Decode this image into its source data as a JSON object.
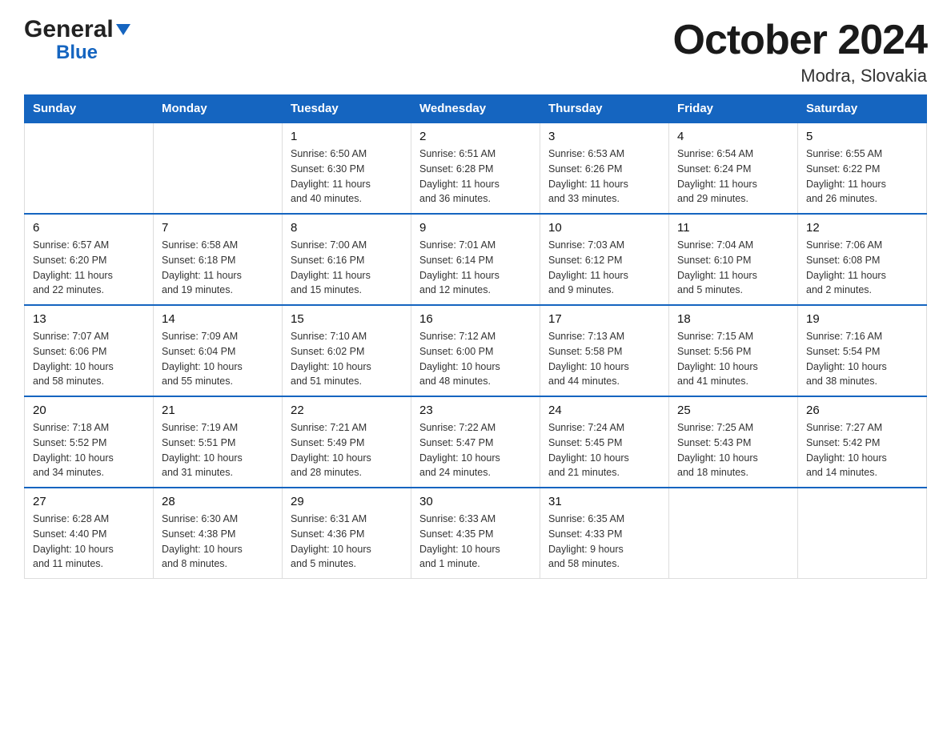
{
  "logo": {
    "general": "General",
    "blue": "Blue"
  },
  "title": "October 2024",
  "location": "Modra, Slovakia",
  "days_of_week": [
    "Sunday",
    "Monday",
    "Tuesday",
    "Wednesday",
    "Thursday",
    "Friday",
    "Saturday"
  ],
  "weeks": [
    [
      {
        "day": "",
        "info": ""
      },
      {
        "day": "",
        "info": ""
      },
      {
        "day": "1",
        "info": "Sunrise: 6:50 AM\nSunset: 6:30 PM\nDaylight: 11 hours\nand 40 minutes."
      },
      {
        "day": "2",
        "info": "Sunrise: 6:51 AM\nSunset: 6:28 PM\nDaylight: 11 hours\nand 36 minutes."
      },
      {
        "day": "3",
        "info": "Sunrise: 6:53 AM\nSunset: 6:26 PM\nDaylight: 11 hours\nand 33 minutes."
      },
      {
        "day": "4",
        "info": "Sunrise: 6:54 AM\nSunset: 6:24 PM\nDaylight: 11 hours\nand 29 minutes."
      },
      {
        "day": "5",
        "info": "Sunrise: 6:55 AM\nSunset: 6:22 PM\nDaylight: 11 hours\nand 26 minutes."
      }
    ],
    [
      {
        "day": "6",
        "info": "Sunrise: 6:57 AM\nSunset: 6:20 PM\nDaylight: 11 hours\nand 22 minutes."
      },
      {
        "day": "7",
        "info": "Sunrise: 6:58 AM\nSunset: 6:18 PM\nDaylight: 11 hours\nand 19 minutes."
      },
      {
        "day": "8",
        "info": "Sunrise: 7:00 AM\nSunset: 6:16 PM\nDaylight: 11 hours\nand 15 minutes."
      },
      {
        "day": "9",
        "info": "Sunrise: 7:01 AM\nSunset: 6:14 PM\nDaylight: 11 hours\nand 12 minutes."
      },
      {
        "day": "10",
        "info": "Sunrise: 7:03 AM\nSunset: 6:12 PM\nDaylight: 11 hours\nand 9 minutes."
      },
      {
        "day": "11",
        "info": "Sunrise: 7:04 AM\nSunset: 6:10 PM\nDaylight: 11 hours\nand 5 minutes."
      },
      {
        "day": "12",
        "info": "Sunrise: 7:06 AM\nSunset: 6:08 PM\nDaylight: 11 hours\nand 2 minutes."
      }
    ],
    [
      {
        "day": "13",
        "info": "Sunrise: 7:07 AM\nSunset: 6:06 PM\nDaylight: 10 hours\nand 58 minutes."
      },
      {
        "day": "14",
        "info": "Sunrise: 7:09 AM\nSunset: 6:04 PM\nDaylight: 10 hours\nand 55 minutes."
      },
      {
        "day": "15",
        "info": "Sunrise: 7:10 AM\nSunset: 6:02 PM\nDaylight: 10 hours\nand 51 minutes."
      },
      {
        "day": "16",
        "info": "Sunrise: 7:12 AM\nSunset: 6:00 PM\nDaylight: 10 hours\nand 48 minutes."
      },
      {
        "day": "17",
        "info": "Sunrise: 7:13 AM\nSunset: 5:58 PM\nDaylight: 10 hours\nand 44 minutes."
      },
      {
        "day": "18",
        "info": "Sunrise: 7:15 AM\nSunset: 5:56 PM\nDaylight: 10 hours\nand 41 minutes."
      },
      {
        "day": "19",
        "info": "Sunrise: 7:16 AM\nSunset: 5:54 PM\nDaylight: 10 hours\nand 38 minutes."
      }
    ],
    [
      {
        "day": "20",
        "info": "Sunrise: 7:18 AM\nSunset: 5:52 PM\nDaylight: 10 hours\nand 34 minutes."
      },
      {
        "day": "21",
        "info": "Sunrise: 7:19 AM\nSunset: 5:51 PM\nDaylight: 10 hours\nand 31 minutes."
      },
      {
        "day": "22",
        "info": "Sunrise: 7:21 AM\nSunset: 5:49 PM\nDaylight: 10 hours\nand 28 minutes."
      },
      {
        "day": "23",
        "info": "Sunrise: 7:22 AM\nSunset: 5:47 PM\nDaylight: 10 hours\nand 24 minutes."
      },
      {
        "day": "24",
        "info": "Sunrise: 7:24 AM\nSunset: 5:45 PM\nDaylight: 10 hours\nand 21 minutes."
      },
      {
        "day": "25",
        "info": "Sunrise: 7:25 AM\nSunset: 5:43 PM\nDaylight: 10 hours\nand 18 minutes."
      },
      {
        "day": "26",
        "info": "Sunrise: 7:27 AM\nSunset: 5:42 PM\nDaylight: 10 hours\nand 14 minutes."
      }
    ],
    [
      {
        "day": "27",
        "info": "Sunrise: 6:28 AM\nSunset: 4:40 PM\nDaylight: 10 hours\nand 11 minutes."
      },
      {
        "day": "28",
        "info": "Sunrise: 6:30 AM\nSunset: 4:38 PM\nDaylight: 10 hours\nand 8 minutes."
      },
      {
        "day": "29",
        "info": "Sunrise: 6:31 AM\nSunset: 4:36 PM\nDaylight: 10 hours\nand 5 minutes."
      },
      {
        "day": "30",
        "info": "Sunrise: 6:33 AM\nSunset: 4:35 PM\nDaylight: 10 hours\nand 1 minute."
      },
      {
        "day": "31",
        "info": "Sunrise: 6:35 AM\nSunset: 4:33 PM\nDaylight: 9 hours\nand 58 minutes."
      },
      {
        "day": "",
        "info": ""
      },
      {
        "day": "",
        "info": ""
      }
    ]
  ]
}
